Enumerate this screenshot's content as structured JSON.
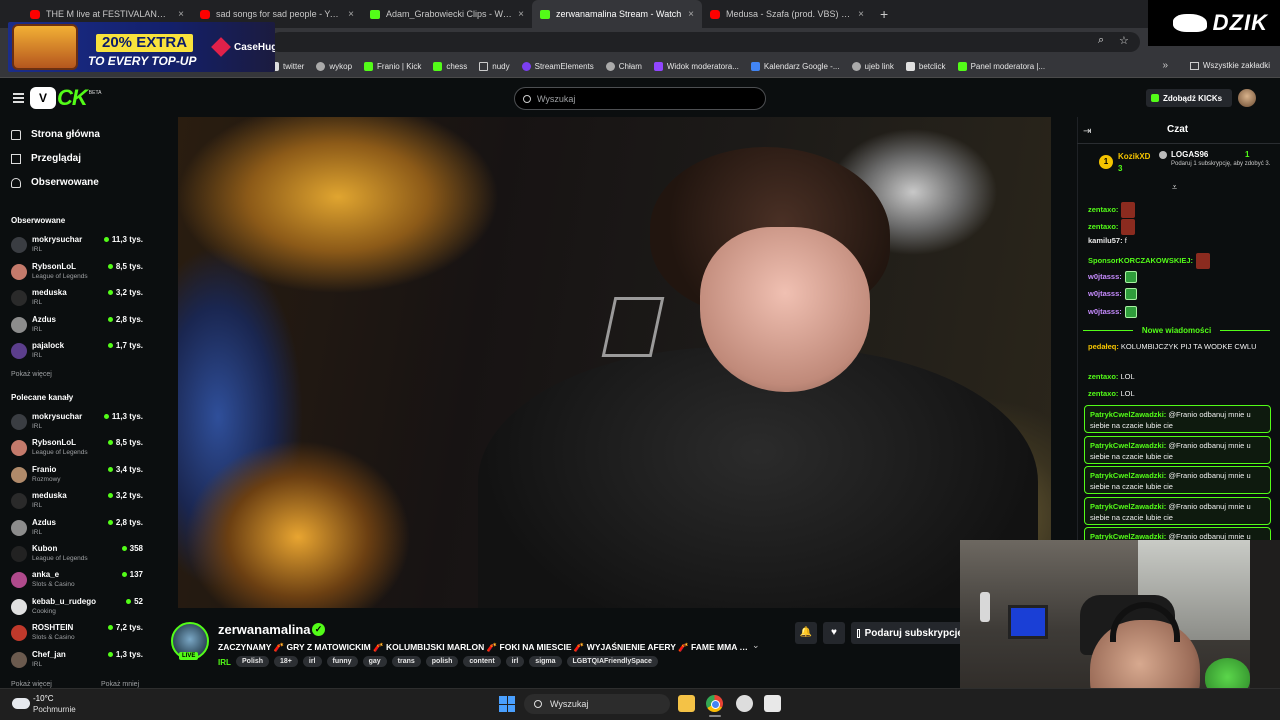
{
  "browser": {
    "tabs": [
      {
        "title": "THE M live at FESTIVALAND 2024",
        "icon": "youtube-icon",
        "active": false
      },
      {
        "title": "sad songs for sad people - YouTube",
        "icon": "youtube-icon",
        "active": false
      },
      {
        "title": "Adam_Grabowiecki Clips - Watch",
        "icon": "kick-icon",
        "active": false
      },
      {
        "title": "zerwanamalina Stream - Watch",
        "icon": "kick-icon",
        "active": true
      },
      {
        "title": "Medusa - Szafa (prod. VBS) - YouTube",
        "icon": "youtube-icon",
        "active": false
      }
    ],
    "new_tab": "+",
    "bookmarks": [
      {
        "label": "twitter",
        "icon": "tw"
      },
      {
        "label": "wykop",
        "icon": "circle"
      },
      {
        "label": "Franio | Kick",
        "icon": "k"
      },
      {
        "label": "chess",
        "icon": "k"
      },
      {
        "label": "nudy",
        "icon": "folder"
      },
      {
        "label": "StreamElements",
        "icon": "se"
      },
      {
        "label": "Chłam",
        "icon": "circle"
      },
      {
        "label": "Widok moderatora...",
        "icon": "tv"
      },
      {
        "label": "Kalendarz Google -...",
        "icon": "gc"
      },
      {
        "label": "ujeb link",
        "icon": "circle"
      },
      {
        "label": "betclick",
        "icon": "bc"
      },
      {
        "label": "Panel moderatora |...",
        "icon": "k"
      }
    ],
    "bookmarks_more": "»",
    "all_bookmarks": "Wszystkie zakładki"
  },
  "overlay": {
    "ad_badge": "20% EXTRA",
    "ad_line2": "TO EVERY TOP-UP",
    "ad_brand": "CaseHug",
    "corner_brand": "DZIK"
  },
  "kick": {
    "logo_mark": "V",
    "logo_text": "CK",
    "beta": "BETA",
    "search_placeholder": "Wyszukaj",
    "get_kicks": "Zdobądź KICKs"
  },
  "sidebar": {
    "nav": [
      {
        "label": "Strona główna",
        "icon": "home-icon"
      },
      {
        "label": "Przeglądaj",
        "icon": "browse-icon"
      },
      {
        "label": "Obserwowane",
        "icon": "heart-icon"
      }
    ],
    "followed_title": "Obserwowane",
    "followed": [
      {
        "name": "mokrysuchar",
        "category": "IRL",
        "viewers": "11,3 tys.",
        "color": "#3a3d42"
      },
      {
        "name": "RybsonLoL",
        "category": "League of Legends",
        "viewers": "8,5 tys.",
        "color": "#c47a6b"
      },
      {
        "name": "meduska",
        "category": "IRL",
        "viewers": "3,2 tys.",
        "color": "#2a2a2a"
      },
      {
        "name": "Azdus",
        "category": "IRL",
        "viewers": "2,8 tys.",
        "color": "#8c8c8c"
      },
      {
        "name": "pajalock",
        "category": "IRL",
        "viewers": "1,7 tys.",
        "color": "#5c3e8c"
      }
    ],
    "followed_more": "Pokaż więcej",
    "recommended_title": "Polecane kanały",
    "recommended": [
      {
        "name": "mokrysuchar",
        "category": "IRL",
        "viewers": "11,3 tys.",
        "color": "#3a3d42"
      },
      {
        "name": "RybsonLoL",
        "category": "League of Legends",
        "viewers": "8,5 tys.",
        "color": "#c47a6b"
      },
      {
        "name": "Franio",
        "category": "Rozmowy",
        "viewers": "3,4 tys.",
        "color": "#b08a6a"
      },
      {
        "name": "meduska",
        "category": "IRL",
        "viewers": "3,2 tys.",
        "color": "#2a2a2a"
      },
      {
        "name": "Azdus",
        "category": "IRL",
        "viewers": "2,8 tys.",
        "color": "#8c8c8c"
      },
      {
        "name": "Kubon",
        "category": "League of Legends",
        "viewers": "358",
        "color": "#222222"
      },
      {
        "name": "anka_e",
        "category": "Slots & Casino",
        "viewers": "137",
        "color": "#b04a8c"
      },
      {
        "name": "kebab_u_rudego",
        "category": "Cooking",
        "viewers": "52",
        "color": "#e0e0e0"
      },
      {
        "name": "ROSHTEIN",
        "category": "Slots & Casino",
        "viewers": "7,2 tys.",
        "color": "#c0392b"
      },
      {
        "name": "Chef_jan",
        "category": "IRL",
        "viewers": "1,3 tys.",
        "color": "#6b5a4e"
      }
    ],
    "show_more": "Pokaż więcej",
    "show_less": "Pokaż mniej"
  },
  "stream": {
    "channel": "zerwanamalina",
    "live_badge": "LIVE",
    "title": "ZACZYNAMY 🧨 GRY Z MATOWICKIM 🧨 KOLUMBIJSKI MARLON 🧨 FOKI NA MIESCIE 🧨 WYJAŚNIENIE AFERY 🧨 FAME MMA | !ki...",
    "category": "IRL",
    "tags": [
      "Polish",
      "18+",
      "irl",
      "funny",
      "gay",
      "trans",
      "polish",
      "content",
      "irl",
      "sigma",
      "LGBTQIAFriendlySpace"
    ],
    "subscribe_label": "Podaruj subskrypcje"
  },
  "chat": {
    "title": "Czat",
    "leaderboard": {
      "first_rank": "1",
      "first_name": "KozikXD",
      "first_value": "3",
      "second_name": "LOGAS96",
      "second_value": "1",
      "second_sub": "Podaruj 1 subskrypcję, aby zdobyć 3."
    },
    "messages": [
      {
        "user": "zentaxo:",
        "text": "",
        "color": "#53fc18",
        "emote": "red"
      },
      {
        "user": "zentaxo:",
        "text": "",
        "color": "#53fc18",
        "emote": "red"
      },
      {
        "user": "kamilu57:",
        "text": " f",
        "color": "#e8e8e8",
        "emote": ""
      },
      {
        "user": "SponsorKORCZAKOWSKIEJ:",
        "text": "",
        "color": "#53fc18",
        "emote": "red"
      },
      {
        "user": "w0jtasss:",
        "text": "",
        "color": "#c78cff",
        "emote": "green"
      },
      {
        "user": "w0jtasss:",
        "text": "",
        "color": "#c78cff",
        "emote": "green"
      },
      {
        "user": "w0jtasss:",
        "text": "",
        "color": "#c78cff",
        "emote": "green"
      }
    ],
    "new_messages": "Nowe wiadomości",
    "after_messages": [
      {
        "user": "pedałeq:",
        "text": " KOLUMBIJCZYK PIJ TA WODKE CWLU",
        "color": "#f5c400"
      },
      {
        "user": "zentaxo:",
        "text": " LOL",
        "color": "#53fc18"
      },
      {
        "user": "zentaxo:",
        "text": " LOL",
        "color": "#53fc18"
      }
    ],
    "highlighted": [
      {
        "user": "PatrykCwelZawadzki:",
        "text": " @Franio odbanuj mnie u siebie na czacie lubie cie"
      },
      {
        "user": "PatrykCwelZawadzki:",
        "text": " @Franio odbanuj mnie u siebie na czacie lubie cie"
      },
      {
        "user": "PatrykCwelZawadzki:",
        "text": " @Franio odbanuj mnie u siebie na czacie lubie cie"
      },
      {
        "user": "PatrykCwelZawadzki:",
        "text": " @Franio odbanuj mnie u siebie na czacie lubie cie"
      },
      {
        "user": "PatrykCwelZawadzki:",
        "text": " @Franio odbanuj mnie u siebie na czacie lubie cie"
      }
    ]
  },
  "taskbar": {
    "temperature": "-10°C",
    "condition": "Pochmurnie",
    "search": "Wyszukaj"
  }
}
